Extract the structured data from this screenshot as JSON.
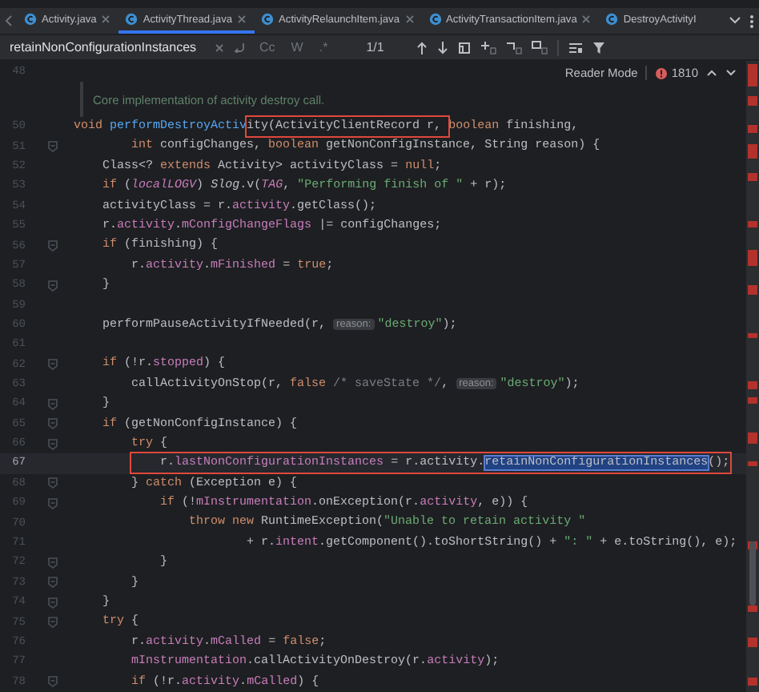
{
  "tabs": [
    {
      "label": "Activity.java",
      "selected": false,
      "closable": true
    },
    {
      "label": "ActivityThread.java",
      "selected": true,
      "closable": true
    },
    {
      "label": "ActivityRelaunchItem.java",
      "selected": false,
      "closable": true
    },
    {
      "label": "ActivityTransactionItem.java",
      "selected": false,
      "closable": true
    },
    {
      "label": "DestroyActivityI",
      "selected": false,
      "closable": false
    }
  ],
  "find_bar": {
    "query": "retainNonConfigurationInstances",
    "options": [
      {
        "label": "Cc",
        "on": false
      },
      {
        "label": "W",
        "on": false
      },
      {
        "label": ".*",
        "on": false
      }
    ],
    "count": "1/1"
  },
  "editor": {
    "reader_mode": "Reader Mode",
    "error_count": "1810",
    "lines": [
      {
        "number": "48"
      },
      {
        "kind": "doc",
        "text": "Core implementation of activity destroy call."
      },
      {
        "number": "50",
        "tokens": [
          {
            "kind": "kw",
            "text": "void "
          },
          {
            "kind": "fn",
            "text": "performDestroyActiv"
          },
          {
            "kind": "plain",
            "text": "ity(ActivityClientRecord r, ",
            "boxed": true
          },
          {
            "kind": "kw",
            "text": "boolean "
          },
          {
            "kind": "plain",
            "text": "finishing,"
          }
        ]
      },
      {
        "number": "51",
        "fold": true,
        "tokens": [
          {
            "kind": "kw",
            "text": "        int "
          },
          {
            "kind": "plain",
            "text": "configChanges, "
          },
          {
            "kind": "kw",
            "text": "boolean "
          },
          {
            "kind": "plain",
            "text": "getNonConfigInstance, String reason) {"
          }
        ]
      },
      {
        "number": "52",
        "tokens": [
          {
            "kind": "plain",
            "text": "    Class<? "
          },
          {
            "kind": "kw",
            "text": "extends "
          },
          {
            "kind": "plain",
            "text": "Activity> activityClass = "
          },
          {
            "kind": "kw",
            "text": "null"
          },
          {
            "kind": "plain",
            "text": ";"
          }
        ]
      },
      {
        "number": "53",
        "tokens": [
          {
            "kind": "kw",
            "text": "    if "
          },
          {
            "kind": "plain",
            "text": "("
          },
          {
            "kind": "const",
            "text": "localLOGV"
          },
          {
            "kind": "plain",
            "text": ") "
          },
          {
            "kind": "static",
            "text": "Slog"
          },
          {
            "kind": "plain",
            "text": ".v("
          },
          {
            "kind": "const",
            "text": "TAG"
          },
          {
            "kind": "plain",
            "text": ", "
          },
          {
            "kind": "str",
            "text": "\"Performing finish of \""
          },
          {
            "kind": "plain",
            "text": " + r);"
          }
        ]
      },
      {
        "number": "54",
        "tokens": [
          {
            "kind": "plain",
            "text": "    activityClass = r."
          },
          {
            "kind": "field",
            "text": "activity"
          },
          {
            "kind": "plain",
            "text": ".getClass();"
          }
        ]
      },
      {
        "number": "55",
        "tokens": [
          {
            "kind": "plain",
            "text": "    r."
          },
          {
            "kind": "field",
            "text": "activity"
          },
          {
            "kind": "plain",
            "text": "."
          },
          {
            "kind": "field",
            "text": "mConfigChangeFlags"
          },
          {
            "kind": "plain",
            "text": " |= configChanges;"
          }
        ]
      },
      {
        "number": "56",
        "fold": true,
        "tokens": [
          {
            "kind": "kw",
            "text": "    if "
          },
          {
            "kind": "plain",
            "text": "(finishing) {"
          }
        ]
      },
      {
        "number": "57",
        "tokens": [
          {
            "kind": "plain",
            "text": "        r."
          },
          {
            "kind": "field",
            "text": "activity"
          },
          {
            "kind": "plain",
            "text": "."
          },
          {
            "kind": "field",
            "text": "mFinished"
          },
          {
            "kind": "plain",
            "text": " = "
          },
          {
            "kind": "kw",
            "text": "true"
          },
          {
            "kind": "plain",
            "text": ";"
          }
        ]
      },
      {
        "number": "58",
        "fold": true,
        "tokens": [
          {
            "kind": "plain",
            "text": "    }"
          }
        ]
      },
      {
        "number": "59"
      },
      {
        "number": "60",
        "tokens": [
          {
            "kind": "plain",
            "text": "    performPauseActivityIfNeeded(r, "
          },
          {
            "kind": "hint",
            "text": "reason:"
          },
          {
            "kind": "str",
            "text": "\"destroy\""
          },
          {
            "kind": "plain",
            "text": ");"
          }
        ]
      },
      {
        "number": "61"
      },
      {
        "number": "62",
        "fold": true,
        "tokens": [
          {
            "kind": "kw",
            "text": "    if "
          },
          {
            "kind": "plain",
            "text": "(!r."
          },
          {
            "kind": "field",
            "text": "stopped"
          },
          {
            "kind": "plain",
            "text": ") {"
          }
        ]
      },
      {
        "number": "63",
        "tokens": [
          {
            "kind": "plain",
            "text": "        callActivityOnStop(r, "
          },
          {
            "kind": "kw",
            "text": "false "
          },
          {
            "kind": "cmt",
            "text": "/* saveState */"
          },
          {
            "kind": "plain",
            "text": ", "
          },
          {
            "kind": "hint",
            "text": "reason:"
          },
          {
            "kind": "str",
            "text": "\"destroy\""
          },
          {
            "kind": "plain",
            "text": ");"
          }
        ]
      },
      {
        "number": "64",
        "fold": true,
        "tokens": [
          {
            "kind": "plain",
            "text": "    }"
          }
        ]
      },
      {
        "number": "65",
        "fold": true,
        "tokens": [
          {
            "kind": "kw",
            "text": "    if "
          },
          {
            "kind": "plain",
            "text": "(getNonConfigInstance) {"
          }
        ]
      },
      {
        "number": "66",
        "fold": true,
        "tokens": [
          {
            "kind": "kw",
            "text": "        try "
          },
          {
            "kind": "plain",
            "text": "{"
          }
        ]
      },
      {
        "number": "67",
        "current": true,
        "tokens": [
          {
            "kind": "plain",
            "text": "            r.",
            "boxed": true
          },
          {
            "kind": "field",
            "text": "lastNonConfigurationInstances",
            "boxed": true
          },
          {
            "kind": "plain",
            "text": " = r.activity.",
            "boxed": true
          },
          {
            "kind": "match",
            "text": "retainNonConfigurationInstances",
            "boxed": true
          },
          {
            "kind": "plain",
            "text": "();",
            "boxed": true
          }
        ]
      },
      {
        "number": "68",
        "fold": true,
        "tokens": [
          {
            "kind": "plain",
            "text": "        } "
          },
          {
            "kind": "kw",
            "text": "catch "
          },
          {
            "kind": "plain",
            "text": "(Exception e) {"
          }
        ]
      },
      {
        "number": "69",
        "fold": true,
        "tokens": [
          {
            "kind": "kw",
            "text": "            if "
          },
          {
            "kind": "plain",
            "text": "(!"
          },
          {
            "kind": "field",
            "text": "mInstrumentation"
          },
          {
            "kind": "plain",
            "text": ".onException(r."
          },
          {
            "kind": "field",
            "text": "activity"
          },
          {
            "kind": "plain",
            "text": ", e)) {"
          }
        ]
      },
      {
        "number": "70",
        "tokens": [
          {
            "kind": "kw",
            "text": "                throw new "
          },
          {
            "kind": "plain",
            "text": "RuntimeException("
          },
          {
            "kind": "str",
            "text": "\"Unable to retain activity \""
          }
        ]
      },
      {
        "number": "71",
        "tokens": [
          {
            "kind": "plain",
            "text": "                        + r."
          },
          {
            "kind": "field",
            "text": "intent"
          },
          {
            "kind": "plain",
            "text": ".getComponent().toShortString() + "
          },
          {
            "kind": "str",
            "text": "\": \""
          },
          {
            "kind": "plain",
            "text": " + e.toString(), e);"
          }
        ]
      },
      {
        "number": "72",
        "fold": true,
        "tokens": [
          {
            "kind": "plain",
            "text": "            }"
          }
        ]
      },
      {
        "number": "73",
        "fold": true,
        "tokens": [
          {
            "kind": "plain",
            "text": "        }"
          }
        ]
      },
      {
        "number": "74",
        "fold": true,
        "tokens": [
          {
            "kind": "plain",
            "text": "    }"
          }
        ]
      },
      {
        "number": "75",
        "fold": true,
        "tokens": [
          {
            "kind": "kw",
            "text": "    try "
          },
          {
            "kind": "plain",
            "text": "{"
          }
        ]
      },
      {
        "number": "76",
        "tokens": [
          {
            "kind": "plain",
            "text": "        r."
          },
          {
            "kind": "field",
            "text": "activity"
          },
          {
            "kind": "plain",
            "text": "."
          },
          {
            "kind": "field",
            "text": "mCalled"
          },
          {
            "kind": "plain",
            "text": " = "
          },
          {
            "kind": "kw",
            "text": "false"
          },
          {
            "kind": "plain",
            "text": ";"
          }
        ]
      },
      {
        "number": "77",
        "tokens": [
          {
            "kind": "field",
            "text": "        mInstrumentation"
          },
          {
            "kind": "plain",
            "text": ".callActivityOnDestroy(r."
          },
          {
            "kind": "field",
            "text": "activity"
          },
          {
            "kind": "plain",
            "text": ");"
          }
        ]
      },
      {
        "number": "78",
        "fold": true,
        "tokens": [
          {
            "kind": "kw",
            "text": "        if "
          },
          {
            "kind": "plain",
            "text": "(!r."
          },
          {
            "kind": "field",
            "text": "activity"
          },
          {
            "kind": "plain",
            "text": "."
          },
          {
            "kind": "field",
            "text": "mCalled"
          },
          {
            "kind": "plain",
            "text": ") {"
          }
        ]
      }
    ]
  }
}
